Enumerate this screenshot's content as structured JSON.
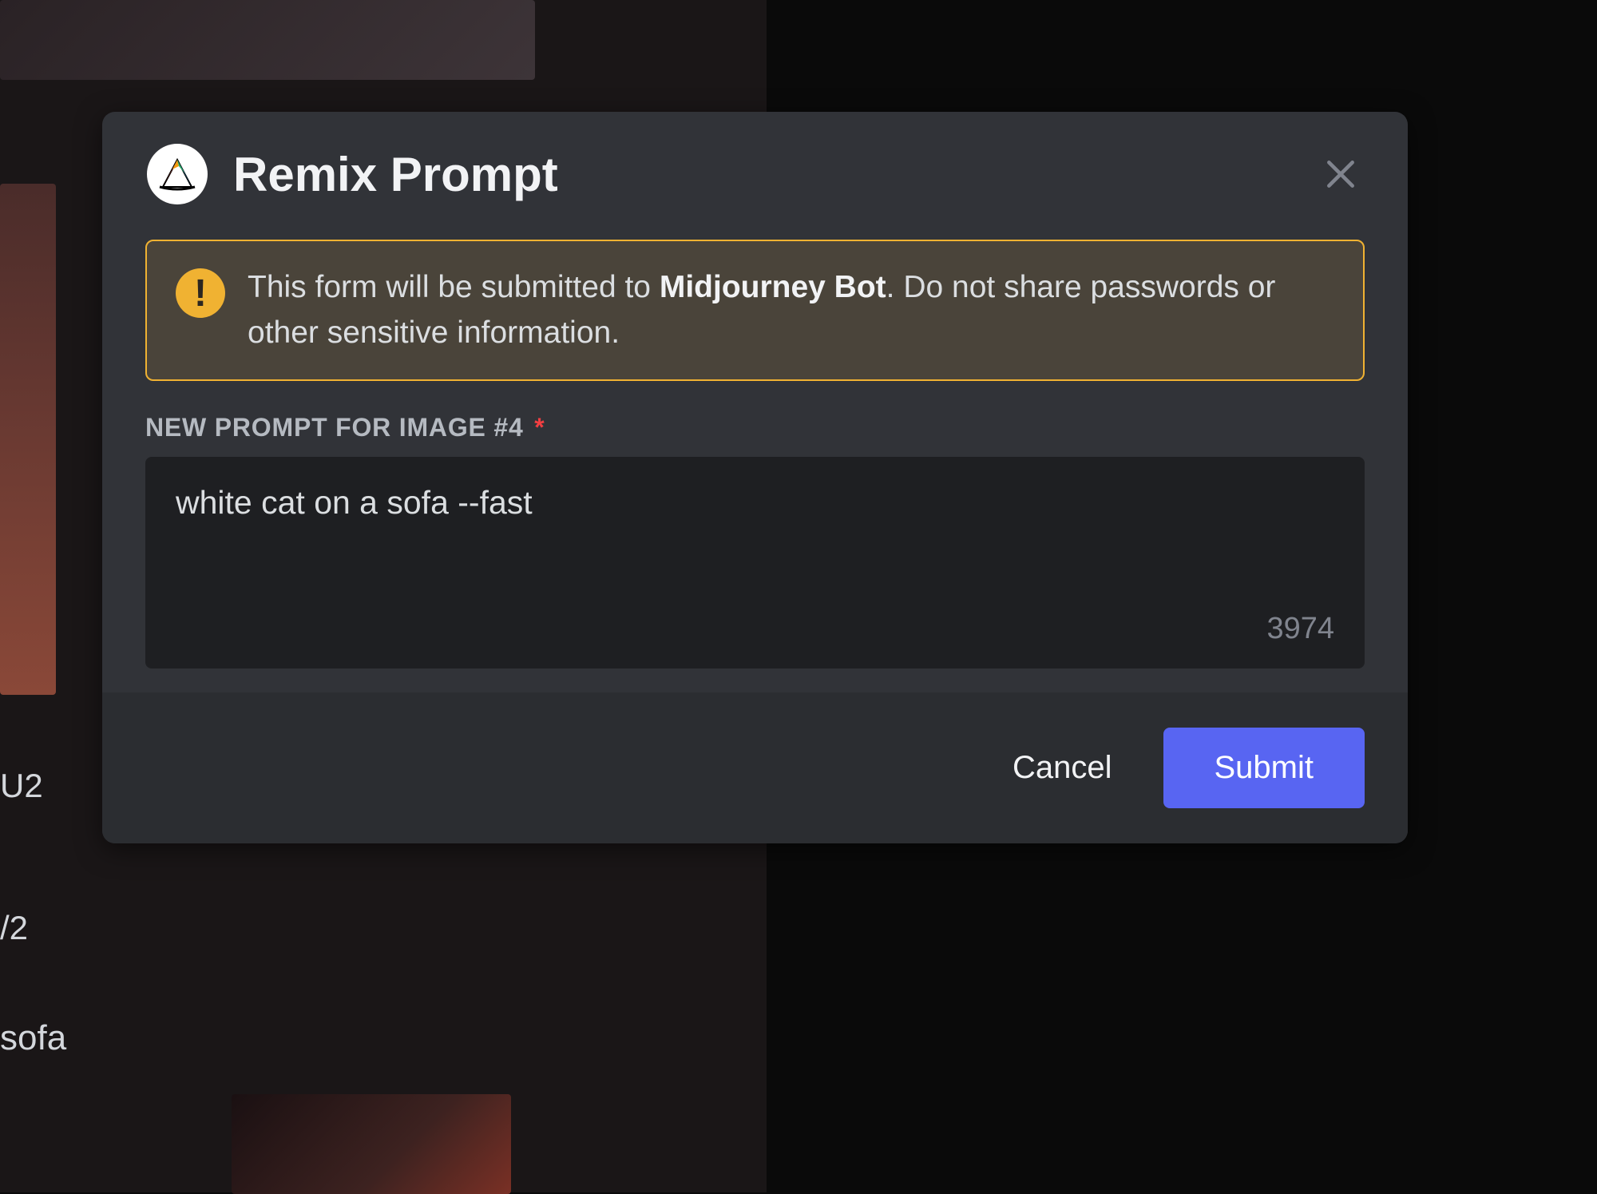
{
  "modal": {
    "title": "Remix Prompt",
    "icon_name": "midjourney-bot-avatar",
    "warning": {
      "text_before_bold": "This form will be submitted to ",
      "bold_text": "Midjourney Bot",
      "text_after_bold": ". Do not share passwords or other sensitive information."
    },
    "field": {
      "label": "NEW PROMPT FOR IMAGE #4",
      "required": "*",
      "value": "white cat on a sofa --fast",
      "char_remaining": "3974"
    },
    "footer": {
      "cancel_label": "Cancel",
      "submit_label": "Submit"
    }
  },
  "background": {
    "button_u2": "U2",
    "button_v2": "/2",
    "prompt_fragment": "sofa"
  },
  "colors": {
    "modal_bg": "#313338",
    "footer_bg": "#2b2d31",
    "input_bg": "#1e1f22",
    "warning_border": "#f0b232",
    "warning_bg": "#4a443a",
    "primary_button": "#5865f2",
    "text_primary": "#f2f3f5",
    "text_secondary": "#b5bac1",
    "text_muted": "#80848e"
  }
}
